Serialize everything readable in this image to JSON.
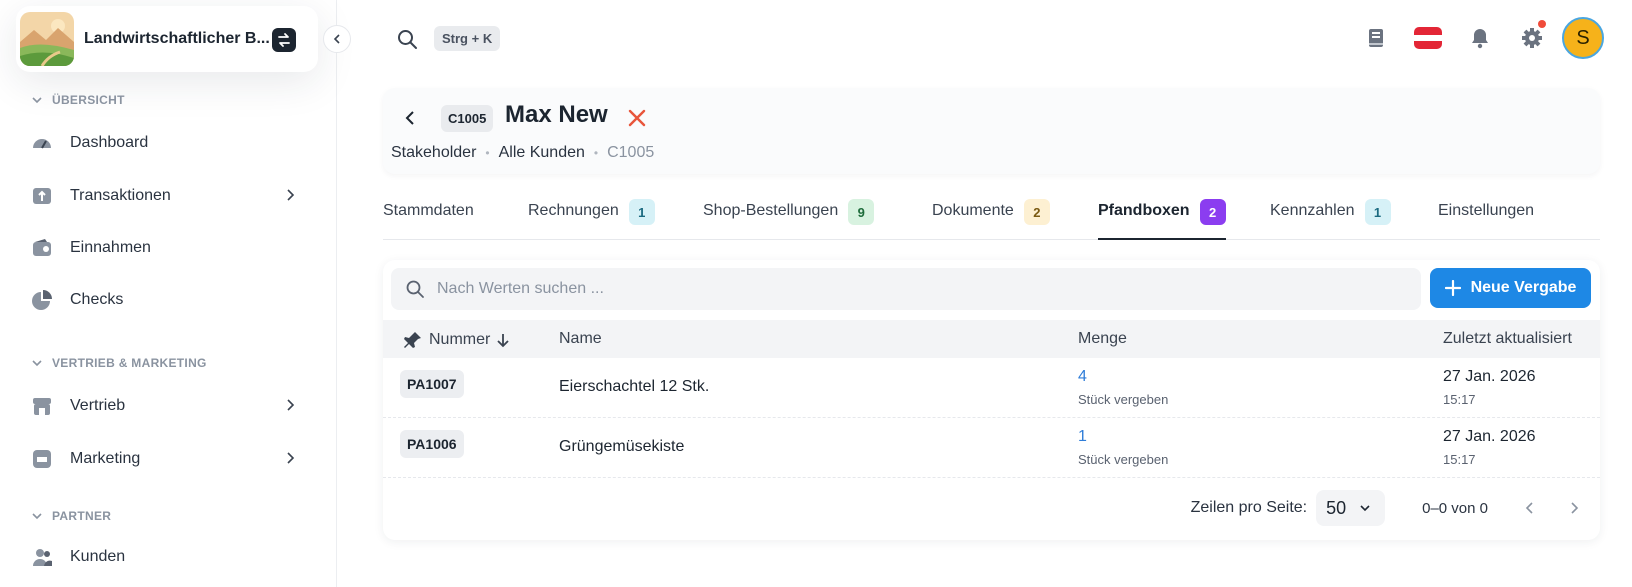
{
  "org": {
    "name": "Landwirtschaftlicher B..."
  },
  "sidebar": {
    "sections": [
      {
        "label": "ÜBERSICHT"
      },
      {
        "label": "VERTRIEB & MARKETING"
      },
      {
        "label": "PARTNER"
      }
    ],
    "items": [
      {
        "label": "Dashboard",
        "icon": "dashboard-gauge-icon"
      },
      {
        "label": "Transaktionen",
        "icon": "transactions-icon"
      },
      {
        "label": "Einnahmen",
        "icon": "wallet-icon"
      },
      {
        "label": "Checks",
        "icon": "pie-chart-icon"
      },
      {
        "label": "Vertrieb",
        "icon": "store-icon"
      },
      {
        "label": "Marketing",
        "icon": "megaphone-icon"
      },
      {
        "label": "Kunden",
        "icon": "users-icon"
      }
    ]
  },
  "topbar": {
    "shortcut": "Strg + K",
    "avatar_initial": "S"
  },
  "header": {
    "id_chip": "C1005",
    "title": "Max New",
    "breadcrumb": [
      "Stakeholder",
      "Alle Kunden",
      "C1005"
    ]
  },
  "tabs": [
    {
      "label": "Stammdaten"
    },
    {
      "label": "Rechnungen",
      "badge": "1",
      "badge_bg": "#d6f1f7",
      "badge_fg": "#1b6a80"
    },
    {
      "label": "Shop-Bestellungen",
      "badge": "9",
      "badge_bg": "#d8f2e0",
      "badge_fg": "#1d6b3a"
    },
    {
      "label": "Dokumente",
      "badge": "2",
      "badge_bg": "#fdf0d2",
      "badge_fg": "#7a5a12"
    },
    {
      "label": "Pfandboxen",
      "badge": "2",
      "badge_bg": "#8b3df0",
      "badge_fg": "#ffffff",
      "active": true
    },
    {
      "label": "Kennzahlen",
      "badge": "1",
      "badge_bg": "#d6f1f7",
      "badge_fg": "#1b6a80"
    },
    {
      "label": "Einstellungen"
    }
  ],
  "table": {
    "search_placeholder": "Nach Werten suchen ...",
    "new_button": "Neue Vergabe",
    "columns": {
      "number": "Nummer",
      "name": "Name",
      "qty": "Menge",
      "updated": "Zuletzt aktualisiert"
    },
    "rows": [
      {
        "id": "PA1007",
        "name": "Eierschachtel 12 Stk.",
        "qty": "4",
        "qty_sub": "Stück vergeben",
        "date": "27 Jan. 2026",
        "time": "15:17"
      },
      {
        "id": "PA1006",
        "name": "Grüngemüsekiste",
        "qty": "1",
        "qty_sub": "Stück vergeben",
        "date": "27 Jan. 2026",
        "time": "15:17"
      }
    ],
    "rows_per_page_label": "Zeilen pro Seite:",
    "rows_per_page": "50",
    "range": "0–0 von 0"
  },
  "colors": {
    "accent": "#1e88e5",
    "active_badge": "#8b3df0",
    "close": "#e8553b",
    "link": "#2f7dd8"
  }
}
